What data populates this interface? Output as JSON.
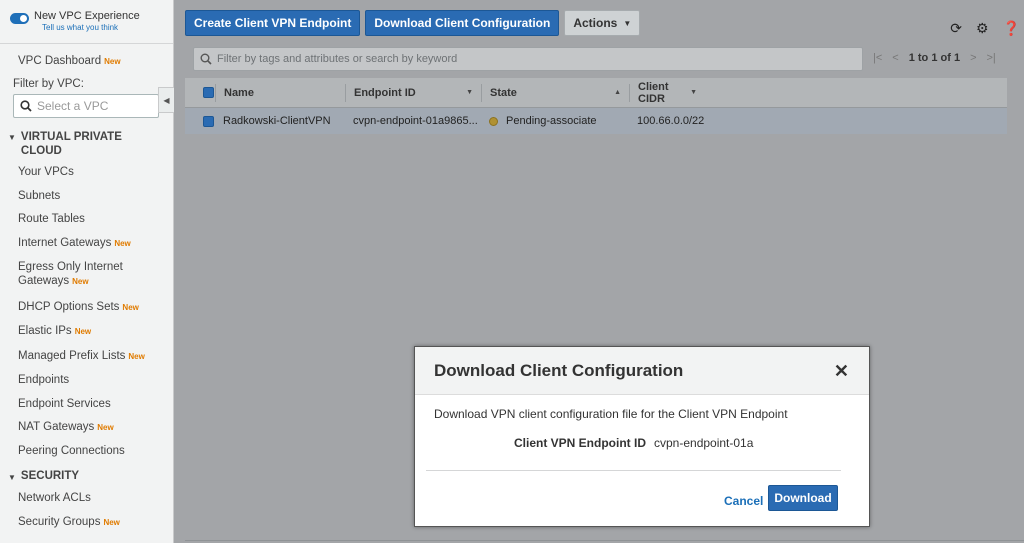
{
  "sidebar": {
    "experience_title": "New VPC Experience",
    "experience_link": "Tell us what you think",
    "dashboard": "VPC Dashboard",
    "new_badge": "New",
    "filter_label": "Filter by VPC:",
    "vpc_placeholder": "Select a VPC",
    "section_vpc": "VIRTUAL PRIVATE CLOUD",
    "section_vpc_line1": "VIRTUAL PRIVATE",
    "section_vpc_line2": "CLOUD",
    "items": [
      {
        "label": "Your VPCs"
      },
      {
        "label": "Subnets"
      },
      {
        "label": "Route Tables"
      },
      {
        "label": "Internet Gateways",
        "new": true
      },
      {
        "label_line1": "Egress Only Internet",
        "label_line2": "Gateways",
        "new": true
      },
      {
        "label": "DHCP Options Sets",
        "new": true
      },
      {
        "label": "Elastic IPs",
        "new": true
      },
      {
        "label": "Managed Prefix Lists",
        "new": true
      },
      {
        "label": "Endpoints"
      },
      {
        "label": "Endpoint Services"
      },
      {
        "label": "NAT Gateways",
        "new": true
      },
      {
        "label": "Peering Connections"
      }
    ],
    "section_security": "SECURITY",
    "security_items": [
      {
        "label": "Network ACLs"
      },
      {
        "label": "Security Groups",
        "new": true
      }
    ]
  },
  "toolbar": {
    "create_label": "Create Client VPN Endpoint",
    "download_label": "Download Client Configuration",
    "actions_label": "Actions"
  },
  "search": {
    "placeholder": "Filter by tags and attributes or search by keyword"
  },
  "pager": {
    "count": "1 to 1 of 1"
  },
  "table": {
    "columns": [
      "Name",
      "Endpoint ID",
      "State",
      "Client CIDR"
    ],
    "rows": [
      {
        "name": "Radkowski-ClientVPN",
        "endpoint_id": "cvpn-endpoint-01a9865...",
        "state": "Pending-associate",
        "cidr": "100.66.0.0/22"
      }
    ]
  },
  "modal": {
    "title": "Download Client Configuration",
    "description": "Download VPN client configuration file for the Client VPN Endpoint",
    "field_label": "Client VPN Endpoint ID",
    "field_value": "cvpn-endpoint-01a",
    "cancel_label": "Cancel",
    "download_label": "Download"
  },
  "colors": {
    "primary": "#2a6bb3",
    "new_badge": "#e07b00",
    "pending": "#b09132"
  }
}
